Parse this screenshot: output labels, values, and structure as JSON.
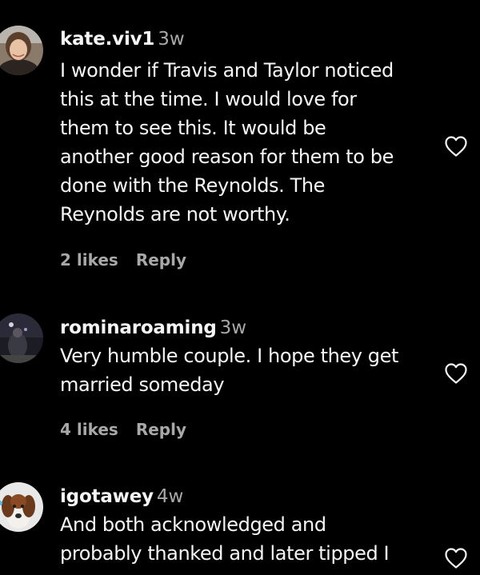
{
  "comments": [
    {
      "username": "kate.viv1",
      "time": "3w",
      "lines": [
        "I wonder if Travis and Taylor noticed",
        "this at the time. I would love for",
        "them to see this. It would be",
        "another good reason for them to be",
        "done with the Reynolds. The",
        "Reynolds are not worthy."
      ],
      "likes": "2 likes",
      "reply": "Reply",
      "heart_icon": "heart-outline-icon"
    },
    {
      "username": "rominaroaming",
      "time": "3w",
      "lines": [
        "Very humble couple. I hope they get",
        "married someday"
      ],
      "likes": "4 likes",
      "reply": "Reply",
      "heart_icon": "heart-outline-icon"
    },
    {
      "username": "igotawey",
      "time": "4w",
      "lines": [
        "And both acknowledged and",
        "probably thanked and later tipped I"
      ],
      "heart_icon": "heart-outline-icon"
    }
  ],
  "colors": {
    "background": "#000000",
    "primary_text": "#f5f5f5",
    "secondary_text": "#a8a8a8"
  }
}
